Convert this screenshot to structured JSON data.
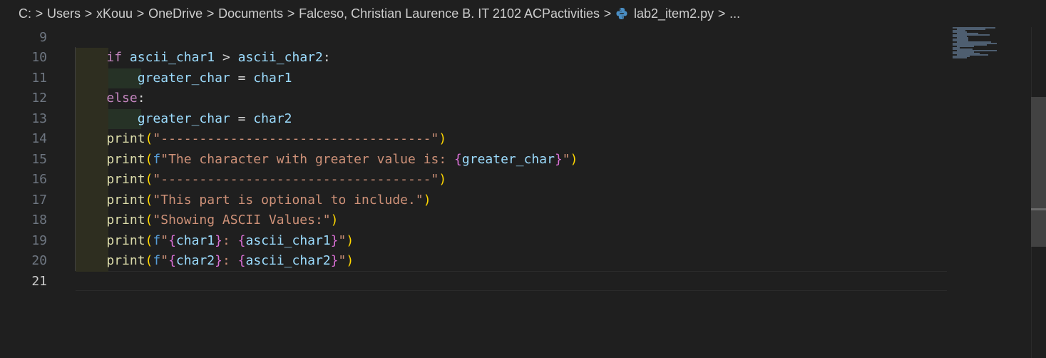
{
  "breadcrumb": {
    "items": [
      "C:",
      "Users",
      "xKouu",
      "OneDrive",
      "Documents",
      "Falceso, Christian Laurence B. IT 2102 ACPactivities",
      "lab2_item2.py",
      "..."
    ],
    "separator": ">"
  },
  "editor": {
    "language": "python",
    "active_line": "21",
    "line_numbers": [
      "9",
      "10",
      "11",
      "12",
      "13",
      "14",
      "15",
      "16",
      "17",
      "18",
      "19",
      "20",
      "21"
    ],
    "lines": [
      {
        "ln": "9",
        "tokens": []
      },
      {
        "ln": "10",
        "tokens": [
          {
            "t": "if",
            "c": "kw"
          },
          {
            "t": " ",
            "c": "op"
          },
          {
            "t": "ascii_char1",
            "c": "id"
          },
          {
            "t": " > ",
            "c": "op"
          },
          {
            "t": "ascii_char2",
            "c": "id"
          },
          {
            "t": ":",
            "c": "op"
          }
        ]
      },
      {
        "ln": "11",
        "tokens": [
          {
            "t": "    ",
            "c": "op"
          },
          {
            "t": "greater_char",
            "c": "id"
          },
          {
            "t": " = ",
            "c": "op"
          },
          {
            "t": "char1",
            "c": "id"
          }
        ]
      },
      {
        "ln": "12",
        "tokens": [
          {
            "t": "else",
            "c": "kw"
          },
          {
            "t": ":",
            "c": "op"
          }
        ]
      },
      {
        "ln": "13",
        "tokens": [
          {
            "t": "    ",
            "c": "op"
          },
          {
            "t": "greater_char",
            "c": "id"
          },
          {
            "t": " = ",
            "c": "op"
          },
          {
            "t": "char2",
            "c": "id"
          }
        ]
      },
      {
        "ln": "14",
        "tokens": [
          {
            "t": "print",
            "c": "fn"
          },
          {
            "t": "(",
            "c": "br1"
          },
          {
            "t": "\"-----------------------------------\"",
            "c": "str"
          },
          {
            "t": ")",
            "c": "br1"
          }
        ]
      },
      {
        "ln": "15",
        "tokens": [
          {
            "t": "print",
            "c": "fn"
          },
          {
            "t": "(",
            "c": "br1"
          },
          {
            "t": "f",
            "c": "fpre"
          },
          {
            "t": "\"The character with greater value is: ",
            "c": "str"
          },
          {
            "t": "{",
            "c": "br2"
          },
          {
            "t": "greater_char",
            "c": "fexp"
          },
          {
            "t": "}",
            "c": "br2"
          },
          {
            "t": "\"",
            "c": "str"
          },
          {
            "t": ")",
            "c": "br1"
          }
        ]
      },
      {
        "ln": "16",
        "tokens": [
          {
            "t": "print",
            "c": "fn"
          },
          {
            "t": "(",
            "c": "br1"
          },
          {
            "t": "\"-----------------------------------\"",
            "c": "str"
          },
          {
            "t": ")",
            "c": "br1"
          }
        ]
      },
      {
        "ln": "17",
        "tokens": [
          {
            "t": "print",
            "c": "fn"
          },
          {
            "t": "(",
            "c": "br1"
          },
          {
            "t": "\"This part is optional to include.\"",
            "c": "str"
          },
          {
            "t": ")",
            "c": "br1"
          }
        ]
      },
      {
        "ln": "18",
        "tokens": [
          {
            "t": "print",
            "c": "fn"
          },
          {
            "t": "(",
            "c": "br1"
          },
          {
            "t": "\"Showing ASCII Values:\"",
            "c": "str"
          },
          {
            "t": ")",
            "c": "br1"
          }
        ]
      },
      {
        "ln": "19",
        "tokens": [
          {
            "t": "print",
            "c": "fn"
          },
          {
            "t": "(",
            "c": "br1"
          },
          {
            "t": "f",
            "c": "fpre"
          },
          {
            "t": "\"",
            "c": "str"
          },
          {
            "t": "{",
            "c": "br2"
          },
          {
            "t": "char1",
            "c": "fexp"
          },
          {
            "t": "}",
            "c": "br2"
          },
          {
            "t": ": ",
            "c": "str"
          },
          {
            "t": "{",
            "c": "br2"
          },
          {
            "t": "ascii_char1",
            "c": "fexp"
          },
          {
            "t": "}",
            "c": "br2"
          },
          {
            "t": "\"",
            "c": "str"
          },
          {
            "t": ")",
            "c": "br1"
          }
        ]
      },
      {
        "ln": "20",
        "tokens": [
          {
            "t": "print",
            "c": "fn"
          },
          {
            "t": "(",
            "c": "br1"
          },
          {
            "t": "f",
            "c": "fpre"
          },
          {
            "t": "\"",
            "c": "str"
          },
          {
            "t": "{",
            "c": "br2"
          },
          {
            "t": "char2",
            "c": "fexp"
          },
          {
            "t": "}",
            "c": "br2"
          },
          {
            "t": ": ",
            "c": "str"
          },
          {
            "t": "{",
            "c": "br2"
          },
          {
            "t": "ascii_char2",
            "c": "fexp"
          },
          {
            "t": "}",
            "c": "br2"
          },
          {
            "t": "\"",
            "c": "str"
          },
          {
            "t": ")",
            "c": "br1"
          }
        ]
      },
      {
        "ln": "21",
        "tokens": []
      }
    ]
  },
  "icons": {
    "python_file": "python-icon"
  },
  "colors": {
    "background": "#1f1f1f",
    "keyword": "#c586c0",
    "identifier": "#9cdcfe",
    "function": "#dcdcaa",
    "string": "#ce9178",
    "bracket_level1": "#ffd700",
    "bracket_level2": "#da70d6",
    "fstring_prefix": "#569cd6"
  }
}
